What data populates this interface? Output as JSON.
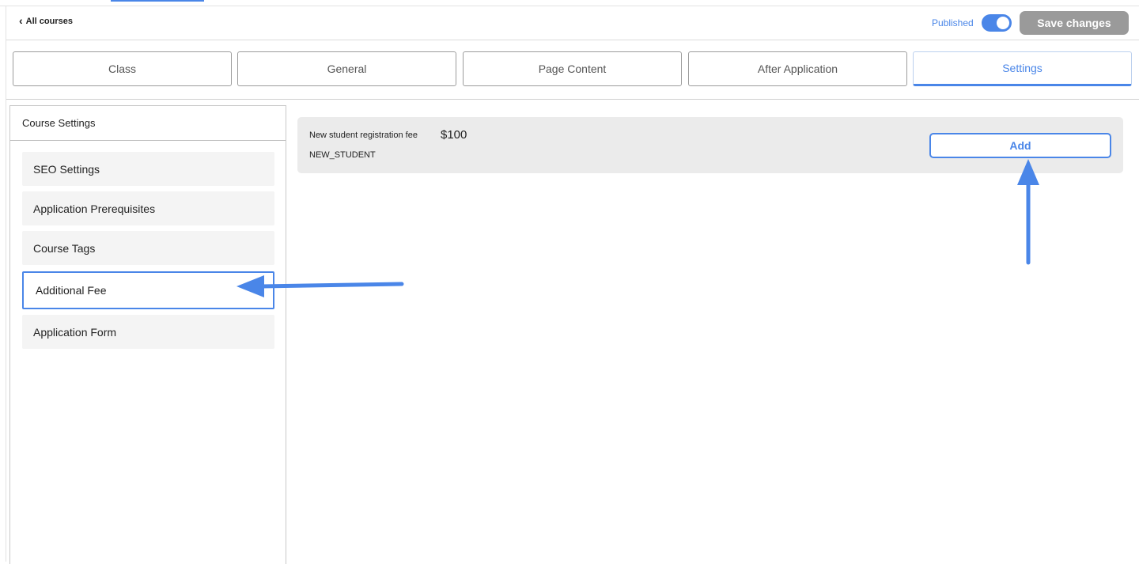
{
  "header": {
    "back_label": "All courses",
    "published_label": "Published",
    "published_on": true,
    "save_label": "Save changes"
  },
  "tabs": [
    {
      "label": "Class"
    },
    {
      "label": "General"
    },
    {
      "label": "Page Content"
    },
    {
      "label": "After Application"
    },
    {
      "label": "Settings"
    }
  ],
  "active_tab": "Settings",
  "sidebar": {
    "title": "Course Settings",
    "items": [
      {
        "label": "SEO Settings"
      },
      {
        "label": "Application Prerequisites"
      },
      {
        "label": "Course Tags"
      },
      {
        "label": "Additional Fee"
      },
      {
        "label": "Application Form"
      }
    ],
    "selected_item": "Additional Fee"
  },
  "fee": {
    "name": "New student registration fee",
    "amount": "$100",
    "code": "NEW_STUDENT",
    "add_label": "Add"
  },
  "colors": {
    "accent": "#4a86e8",
    "save_button": "#9a9a9a",
    "row_background": "#ebebeb"
  },
  "icons": {
    "back": "chevron-left-icon"
  }
}
